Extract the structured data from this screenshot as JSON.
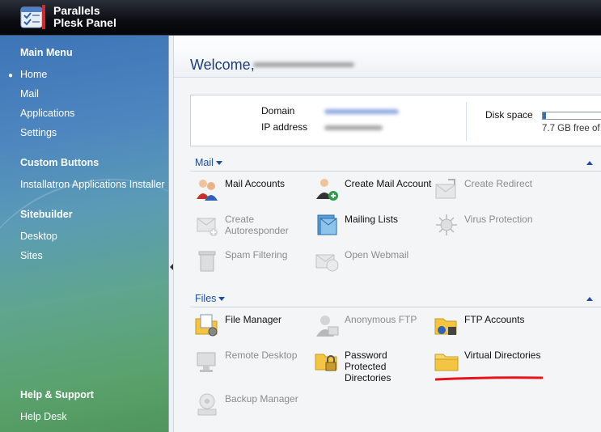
{
  "header": {
    "brand_line1": "Parallels",
    "brand_line2": "Plesk Panel"
  },
  "sidebar": {
    "main_menu_title": "Main Menu",
    "main_menu": [
      "Home",
      "Mail",
      "Applications",
      "Settings"
    ],
    "custom_buttons_title": "Custom Buttons",
    "custom_buttons": [
      "Installatron Applications Installer"
    ],
    "sitebuilder_title": "Sitebuilder",
    "sitebuilder": [
      "Desktop",
      "Sites"
    ],
    "help_title": "Help & Support",
    "help": [
      "Help Desk"
    ]
  },
  "main": {
    "welcome": "Welcome,",
    "domain_label": "Domain",
    "ip_label": "IP address",
    "disk_label": "Disk space",
    "disk_free": "7.7 GB free of",
    "disk_used_fraction": 0.05,
    "mail_section": "Mail",
    "files_section": "Files",
    "mail_tiles": [
      {
        "label": "Mail Accounts",
        "enabled": true
      },
      {
        "label": "Create Mail Account",
        "enabled": true
      },
      {
        "label": "Create Redirect",
        "enabled": false
      },
      {
        "label": "Create Autoresponder",
        "enabled": false
      },
      {
        "label": "Mailing Lists",
        "enabled": true
      },
      {
        "label": "Virus Protection",
        "enabled": false
      },
      {
        "label": "Spam Filtering",
        "enabled": false
      },
      {
        "label": "Open Webmail",
        "enabled": false
      }
    ],
    "files_tiles": [
      {
        "label": "File Manager",
        "enabled": true
      },
      {
        "label": "Anonymous FTP",
        "enabled": false
      },
      {
        "label": "FTP Accounts",
        "enabled": true
      },
      {
        "label": "Remote Desktop",
        "enabled": false
      },
      {
        "label": "Password Protected Directories",
        "enabled": true
      },
      {
        "label": "Virtual Directories",
        "enabled": true
      },
      {
        "label": "Backup Manager",
        "enabled": false
      }
    ]
  },
  "colors": {
    "accent": "#1d4ea0",
    "annotation": "#e8141c"
  }
}
